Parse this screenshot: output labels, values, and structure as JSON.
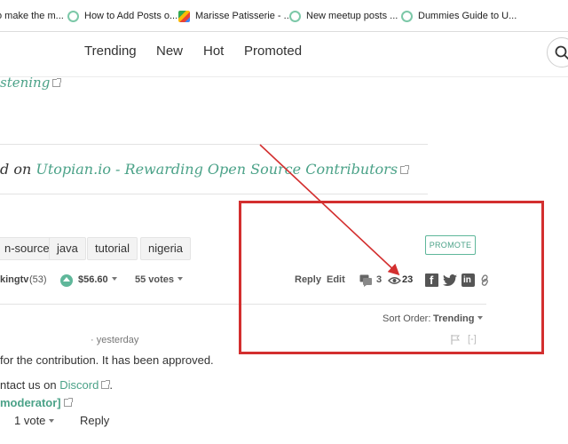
{
  "bookmarks": [
    {
      "label": "o make the m...",
      "icon": "steem-icon"
    },
    {
      "label": "How to Add Posts o...",
      "icon": "steem-icon"
    },
    {
      "label": "Marisse Patisserie - ...",
      "icon": "map-icon"
    },
    {
      "label": "New meetup posts ...",
      "icon": "steem-icon"
    },
    {
      "label": "Dummies Guide to U...",
      "icon": "steem-icon"
    }
  ],
  "nav": {
    "trending": "Trending",
    "new": "New",
    "hot": "Hot",
    "promoted": "Promoted"
  },
  "post": {
    "listening_fragment": "stening",
    "posted_prefix": "d on",
    "posted_link": "Utopian.io - Rewarding Open Source Contributors",
    "tags": [
      "n-source",
      "java",
      "tutorial",
      "nigeria"
    ],
    "promote_label": "PROMOTE",
    "author_fragment": "kingtv",
    "author_rep": "(53)",
    "payout": "$56.60",
    "votes": "55 votes",
    "reply_label": "Reply",
    "edit_label": "Edit",
    "comments_count": "3",
    "views_count": "23"
  },
  "comments": {
    "sort_label": "Sort Order:",
    "sort_value": "Trending",
    "collapse_label": "[-]",
    "time": "· yesterday",
    "line1": "for the contribution. It has been approved.",
    "line2_prefix": "ntact us on",
    "discord_link": "Discord",
    "moderator_fragment": "moderator]",
    "votes": "1 vote",
    "reply_label": "Reply"
  },
  "colors": {
    "accent": "#4ba288",
    "annotation": "#d32f2f"
  }
}
